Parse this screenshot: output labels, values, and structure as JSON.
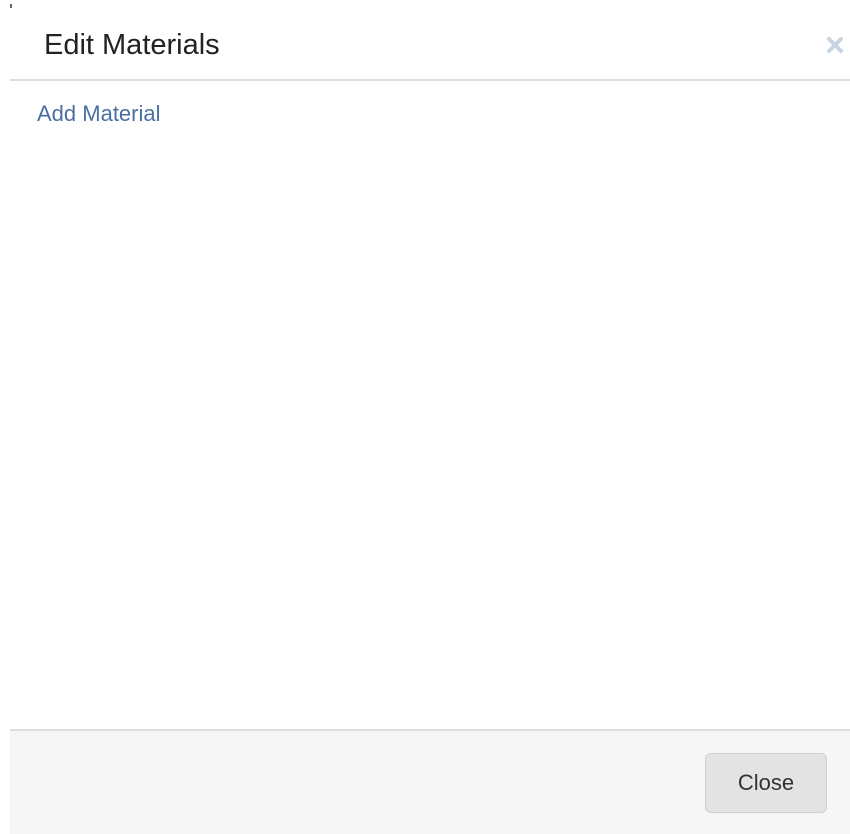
{
  "modal": {
    "title": "Edit Materials",
    "close_icon": "close-icon",
    "body": {
      "add_link": "Add Material"
    },
    "footer": {
      "close_label": "Close"
    }
  },
  "colors": {
    "title": "#222222",
    "link": "#4a6fa0",
    "footer_bg": "#f6f6f6",
    "button_bg": "#e3e3e3",
    "divider": "#dddddd",
    "close_icon": "#c8d4e2"
  }
}
